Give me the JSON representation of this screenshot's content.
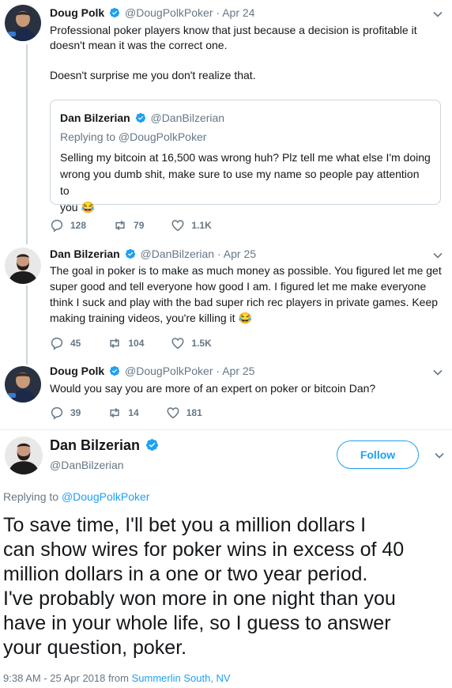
{
  "colors": {
    "accent": "#1da1f2",
    "muted": "#657786",
    "text": "#14171a",
    "border": "#ccd6dd"
  },
  "tweet1": {
    "name": "Doug Polk",
    "handle": "@DougPolkPoker",
    "dot": "·",
    "time": "Apr 24",
    "text_line1": "Professional poker players know that just because a decision is profitable it",
    "text_line2": "doesn't mean it was the correct one.",
    "text_line3": "Doesn't surprise me you don't realize that.",
    "quote": {
      "name": "Dan Bilzerian",
      "handle": "@DanBilzerian",
      "replying": "Replying to @DougPolkPoker",
      "text_line1": "Selling my bitcoin at 16,500 was wrong huh?  Plz tell me what else I'm doing",
      "text_line2": "wrong you dumb shit, make sure to use my name so people pay attention to",
      "text_line3": "you 😂"
    },
    "replies": "128",
    "retweets": "79",
    "likes": "1.1K"
  },
  "tweet2": {
    "name": "Dan Bilzerian",
    "handle": "@DanBilzerian",
    "dot": "·",
    "time": "Apr 25",
    "text_line1": "The goal in poker is to make as much money as possible. You figured let me get",
    "text_line2": "super good and tell everyone how good I am. I figured let me make everyone",
    "text_line3": "think I suck and play with the bad super rich rec players in private games. Keep",
    "text_line4": "making training videos, you're killing it 😂",
    "replies": "45",
    "retweets": "104",
    "likes": "1.5K"
  },
  "tweet3": {
    "name": "Doug Polk",
    "handle": "@DougPolkPoker",
    "dot": "·",
    "time": "Apr 25",
    "text": "Would you say you are more of an expert on poker or bitcoin Dan?",
    "replies": "39",
    "retweets": "14",
    "likes": "181"
  },
  "main": {
    "name": "Dan Bilzerian",
    "handle": "@DanBilzerian",
    "follow_label": "Follow",
    "replying_prefix": "Replying to",
    "replying_link": "@DougPolkPoker",
    "text_line1": "To save time, I'll bet you a million dollars I",
    "text_line2": "can show wires for poker wins in excess of 40",
    "text_line3": "million dollars in a one or two year period.",
    "text_line4": "I've probably won more in one night than you",
    "text_line5": "have in your whole life, so I guess to answer",
    "text_line6": "your question, poker.",
    "timestamp": "9:38 AM - 25 Apr 2018 from",
    "location": "Summerlin South, NV"
  }
}
